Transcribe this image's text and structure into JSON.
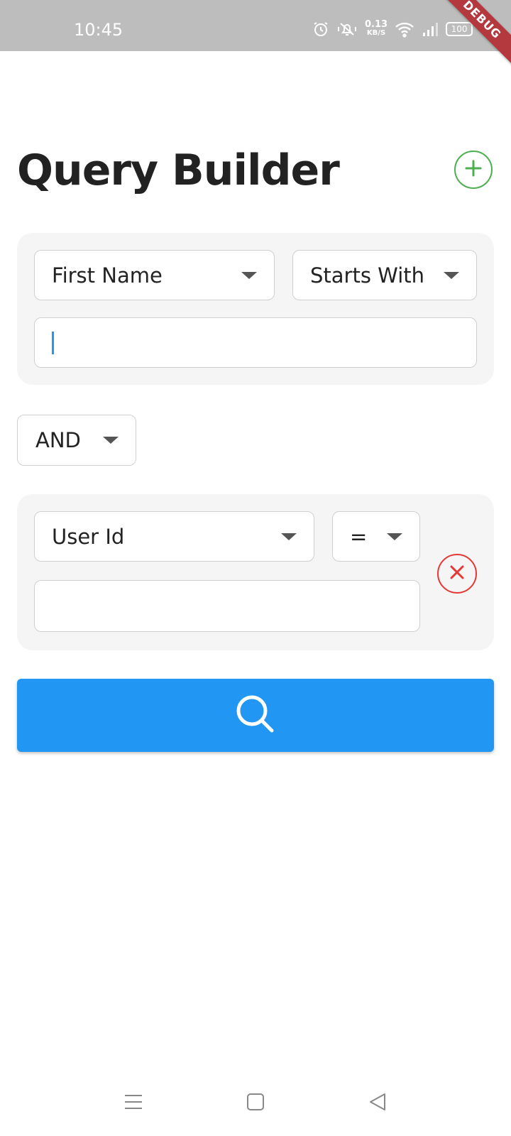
{
  "status_bar": {
    "time": "10:45",
    "net_speed_value": "0.13",
    "net_speed_unit": "KB/S",
    "battery": "100",
    "icons": [
      "alarm-icon",
      "mute-icon",
      "wifi-icon",
      "signal-icon",
      "battery-icon"
    ]
  },
  "debug_banner": "DEBUG",
  "header": {
    "title": "Query Builder",
    "add_icon": "plus-icon",
    "add_color": "#4caf50"
  },
  "conditions": [
    {
      "field": "First Name",
      "operator": "Starts With",
      "value": ""
    },
    {
      "field": "User Id",
      "operator": "=",
      "value": "",
      "remove_icon": "close-icon",
      "remove_color": "#e53935"
    }
  ],
  "logic_operator": "AND",
  "search_button": {
    "icon": "search-icon",
    "color": "#2196f3"
  },
  "nav_bar": {
    "items": [
      "menu-icon",
      "home-icon",
      "back-icon"
    ]
  }
}
